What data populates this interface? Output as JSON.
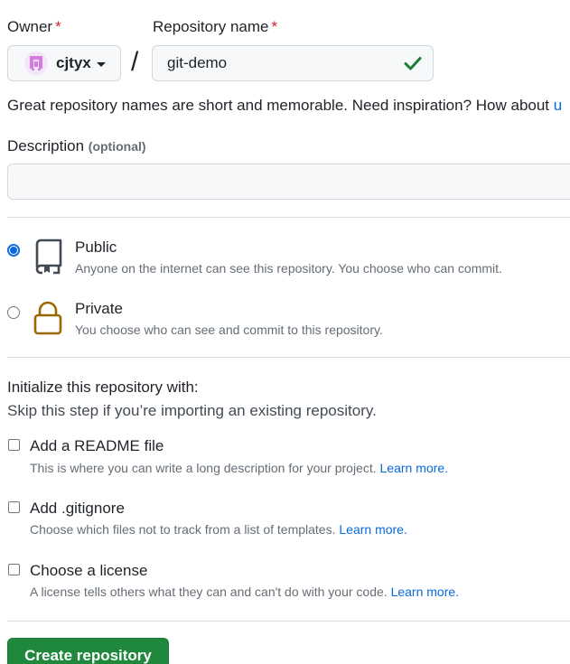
{
  "owner": {
    "label": "Owner",
    "required_mark": "*",
    "name": "cjtyx",
    "avatar_icon": "identicon-avatar"
  },
  "repository": {
    "label": "Repository name",
    "required_mark": "*",
    "value": "git-demo",
    "valid_icon": "check-icon",
    "separator": "/"
  },
  "hint": {
    "text": "Great repository names are short and memorable. Need inspiration? How about ",
    "tail": "u"
  },
  "description": {
    "label": "Description",
    "optional": "(optional)",
    "value": ""
  },
  "visibility": {
    "options": [
      {
        "title": "Public",
        "description": "Anyone on the internet can see this repository. You choose who can commit.",
        "icon": "repo-icon",
        "selected": true
      },
      {
        "title": "Private",
        "description": "You choose who can see and commit to this repository.",
        "icon": "lock-icon",
        "selected": false
      }
    ]
  },
  "initialize": {
    "title": "Initialize this repository with:",
    "subtitle": "Skip this step if you’re importing an existing repository.",
    "options": [
      {
        "title": "Add a README file",
        "description": "This is where you can write a long description for your project.",
        "link": "Learn more."
      },
      {
        "title": "Add .gitignore",
        "description": "Choose which files not to track from a list of templates.",
        "link": "Learn more."
      },
      {
        "title": "Choose a license",
        "description": "A license tells others what they can and can't do with your code.",
        "link": "Learn more."
      }
    ]
  },
  "actions": {
    "create_label": "Create repository"
  },
  "colors": {
    "primary_button": "#1f883d",
    "link": "#0969da",
    "required": "#cf222e",
    "check": "#1a7f37",
    "lock": "#9a6700"
  }
}
